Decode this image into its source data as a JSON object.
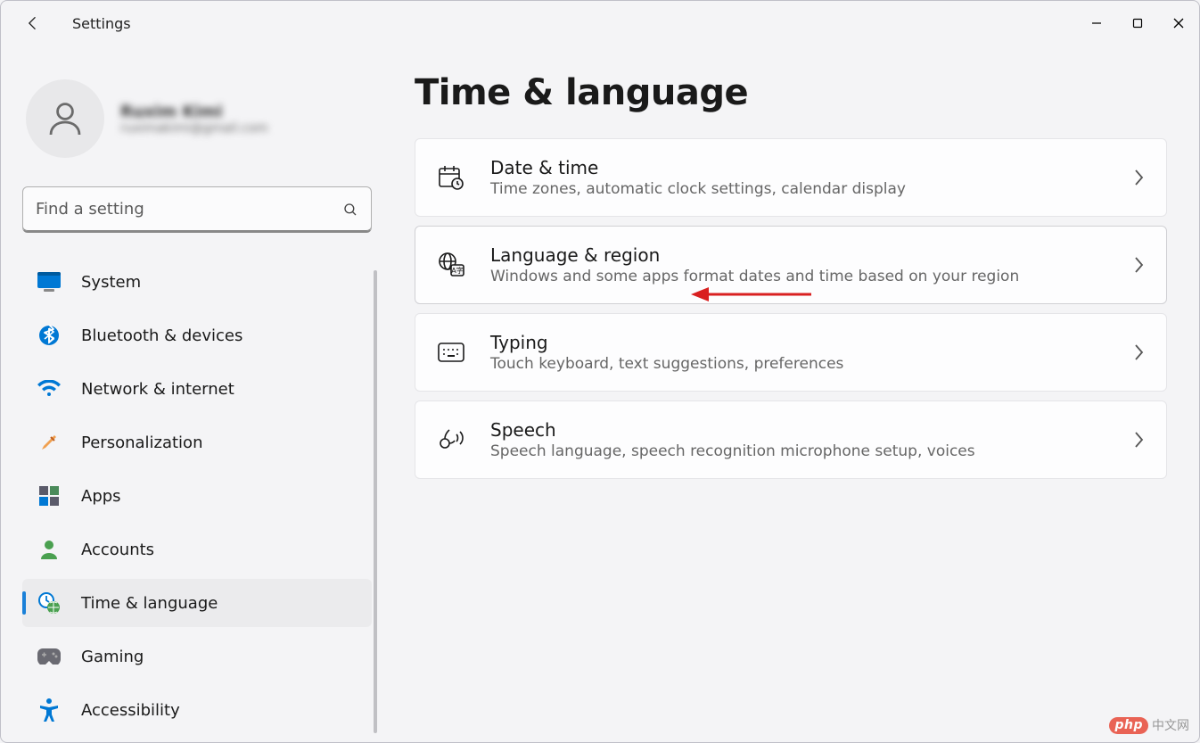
{
  "app": {
    "title": "Settings"
  },
  "profile": {
    "name": "Ruxim Kimi",
    "email": "ruximakimi@gmail.com"
  },
  "search": {
    "placeholder": "Find a setting"
  },
  "sidebar": {
    "items": [
      {
        "label": "System",
        "icon": "system",
        "selected": false
      },
      {
        "label": "Bluetooth & devices",
        "icon": "bluetooth",
        "selected": false
      },
      {
        "label": "Network & internet",
        "icon": "wifi",
        "selected": false
      },
      {
        "label": "Personalization",
        "icon": "personalize",
        "selected": false
      },
      {
        "label": "Apps",
        "icon": "apps",
        "selected": false
      },
      {
        "label": "Accounts",
        "icon": "accounts",
        "selected": false
      },
      {
        "label": "Time & language",
        "icon": "time",
        "selected": true
      },
      {
        "label": "Gaming",
        "icon": "gaming",
        "selected": false
      },
      {
        "label": "Accessibility",
        "icon": "accessibility",
        "selected": false
      }
    ]
  },
  "page": {
    "title": "Time & language"
  },
  "cards": [
    {
      "id": "date-time",
      "icon": "datetime",
      "title": "Date & time",
      "sub": "Time zones, automatic clock settings, calendar display",
      "highlight": false
    },
    {
      "id": "language-region",
      "icon": "langregion",
      "title": "Language & region",
      "sub": "Windows and some apps format dates and time based on your region",
      "highlight": true
    },
    {
      "id": "typing",
      "icon": "typing",
      "title": "Typing",
      "sub": "Touch keyboard, text suggestions, preferences",
      "highlight": false
    },
    {
      "id": "speech",
      "icon": "speech",
      "title": "Speech",
      "sub": "Speech language, speech recognition microphone setup, voices",
      "highlight": false
    }
  ],
  "watermark": {
    "badge": "php",
    "text": "中文网"
  }
}
